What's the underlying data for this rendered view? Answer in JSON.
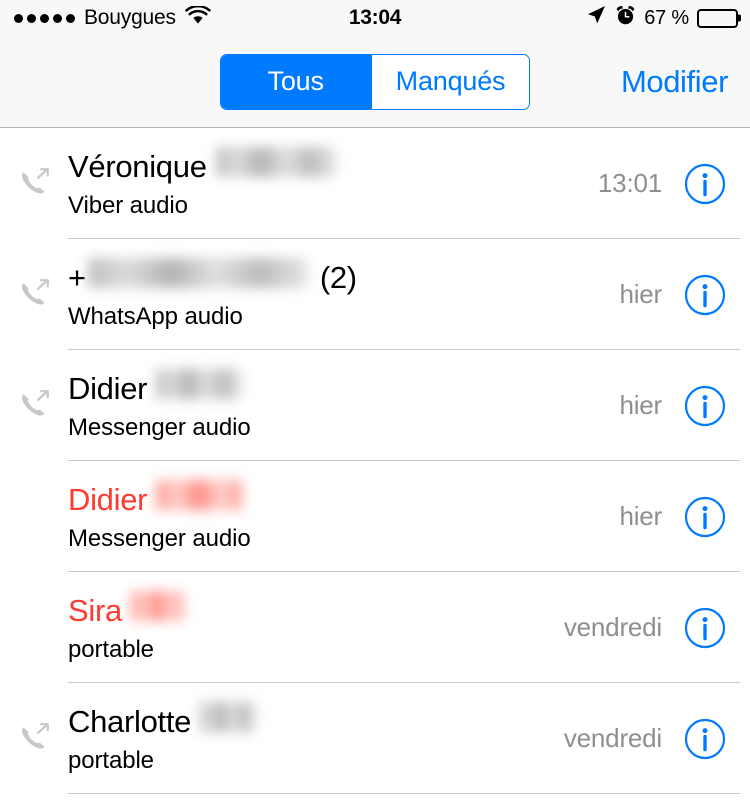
{
  "status_bar": {
    "signal_dots": 5,
    "carrier": "Bouygues",
    "wifi_icon": "wifi-icon",
    "time": "13:04",
    "location_icon": "location-arrow-icon",
    "alarm_icon": "alarm-clock-icon",
    "battery_percent": "67 %",
    "battery_level": 67
  },
  "nav_bar": {
    "segments": [
      {
        "label": "Tous",
        "selected": true
      },
      {
        "label": "Manqués",
        "selected": false
      }
    ],
    "edit_label": "Modifier",
    "accent_color": "#007aff"
  },
  "colors": {
    "accent_blue": "#007aff",
    "missed_red": "#ff3b30",
    "time_gray": "#8e8e93",
    "separator": "#c8c7cc",
    "bar_background": "#f8f8f8"
  },
  "calls": [
    {
      "name": "Véronique",
      "redacted_width": 120,
      "count": "",
      "subtitle": "Viber audio",
      "time": "13:01",
      "missed": false,
      "direction_icon": "outgoing-call-icon",
      "info_icon": "info-circle-icon"
    },
    {
      "name": "+",
      "redacted_width": 220,
      "count": "(2)",
      "subtitle": "WhatsApp audio",
      "time": "hier",
      "missed": false,
      "direction_icon": "outgoing-call-icon",
      "info_icon": "info-circle-icon"
    },
    {
      "name": "Didier",
      "redacted_width": 86,
      "count": "",
      "subtitle": "Messenger audio",
      "time": "hier",
      "missed": false,
      "direction_icon": "outgoing-call-icon",
      "info_icon": "info-circle-icon"
    },
    {
      "name": "Didier",
      "redacted_width": 86,
      "count": "",
      "subtitle": "Messenger audio",
      "time": "hier",
      "missed": true,
      "direction_icon": "",
      "info_icon": "info-circle-icon"
    },
    {
      "name": "Sira",
      "redacted_width": 52,
      "count": "",
      "subtitle": "portable",
      "time": "vendredi",
      "missed": true,
      "direction_icon": "",
      "info_icon": "info-circle-icon"
    },
    {
      "name": "Charlotte",
      "redacted_width": 56,
      "count": "",
      "subtitle": "portable",
      "time": "vendredi",
      "missed": false,
      "direction_icon": "outgoing-call-icon",
      "info_icon": "info-circle-icon"
    }
  ]
}
